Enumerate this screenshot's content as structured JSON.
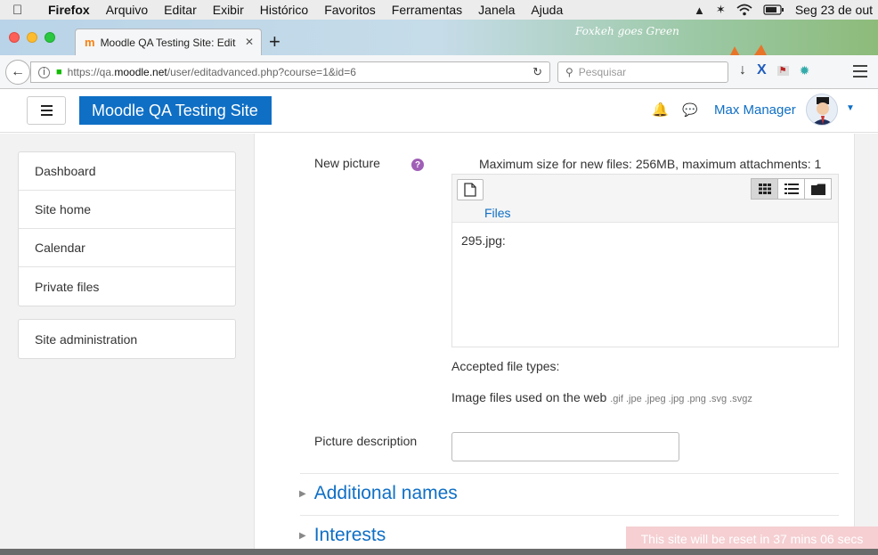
{
  "menubar": {
    "app_name": "Firefox",
    "items": [
      "Arquivo",
      "Editar",
      "Exibir",
      "Histórico",
      "Favoritos",
      "Ferramentas",
      "Janela",
      "Ajuda"
    ],
    "clock": "Seg 23 de out"
  },
  "browser": {
    "tab_title": "Moodle QA Testing Site: Edit p",
    "theme_text": "Foxkeh goes Green",
    "url_prefix": "https://qa.",
    "url_domain": "moodle.net",
    "url_path": "/user/editadvanced.php?course=1&id=6",
    "search_placeholder": "Pesquisar"
  },
  "header": {
    "brand": "Moodle QA Testing Site",
    "user_name": "Max Manager"
  },
  "sidebar": {
    "items": [
      {
        "label": "Dashboard"
      },
      {
        "label": "Site home"
      },
      {
        "label": "Calendar"
      },
      {
        "label": "Private files"
      }
    ],
    "admin_label": "Site administration"
  },
  "form": {
    "new_picture_label": "New picture",
    "max_size": "Maximum size for new files: 256MB, maximum attachments: 1",
    "files_link": "Files",
    "file_name": "295.jpg:",
    "accepted_label": "Accepted file types:",
    "accepted_text": "Image files used on the web",
    "accepted_exts": ".gif .jpe .jpeg .jpg .png .svg .svgz",
    "picture_description_label": "Picture description",
    "picture_description_value": "",
    "sections": [
      "Additional names",
      "Interests"
    ]
  },
  "banner": {
    "reset_text": "This site will be reset in 37 mins 06 secs"
  }
}
